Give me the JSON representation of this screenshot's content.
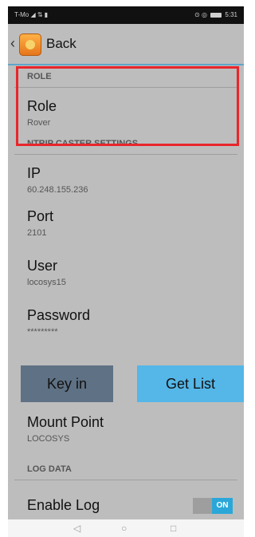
{
  "status_bar": {
    "left": "T-Mo ◢ ⇅ ▮",
    "right_icons": "⊙ ◎",
    "time": "5:31"
  },
  "app_bar": {
    "back_label": "Back"
  },
  "sections": {
    "role": {
      "header": "ROLE",
      "role_item": {
        "title": "Role",
        "summary": "Rover"
      }
    },
    "ntrip": {
      "header": "NTRIP CASTER SETTINGS",
      "ip": {
        "title": "IP",
        "summary": "60.248.155.236"
      },
      "port": {
        "title": "Port",
        "summary": "2101"
      },
      "user": {
        "title": "User",
        "summary": "locosys15"
      },
      "password": {
        "title": "Password",
        "summary": "*********"
      }
    },
    "buttons": {
      "key_in": "Key in",
      "get_list": "Get List"
    },
    "mount_point": {
      "title": "Mount Point",
      "summary": "LOCOSYS"
    },
    "log": {
      "header": "LOG DATA",
      "enable_log": {
        "title": "Enable Log",
        "toggle": "ON"
      }
    }
  },
  "nav": {
    "back": "◁",
    "home": "○",
    "recents": "□"
  },
  "colors": {
    "highlight": "#e8262b",
    "key_in_bg": "#5f7184",
    "get_list_bg": "#55b6e8",
    "toggle_on": "#2aa7d8"
  }
}
